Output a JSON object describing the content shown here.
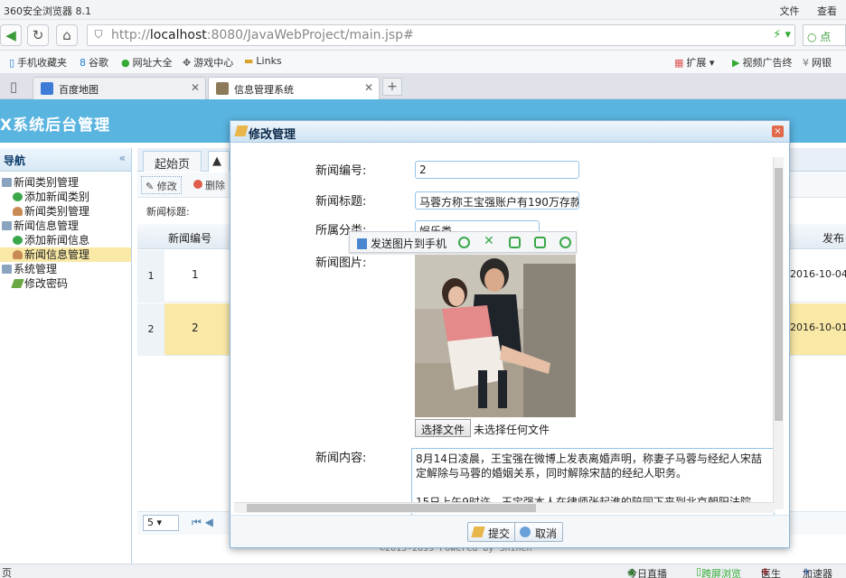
{
  "browser": {
    "title": "360安全浏览器 8.1",
    "menu": [
      "文件",
      "查看"
    ],
    "url_prefix": "http://",
    "url_host": "localhost",
    "url_rest": ":8080/JavaWebProject/main.jsp#",
    "search_text": "点",
    "bookmarks": [
      "手机收藏夹",
      "谷歌",
      "网址大全",
      "游戏中心",
      "Links",
      "扩展",
      "视频广告终",
      "网银"
    ],
    "tabs": [
      {
        "label": "百度地图"
      },
      {
        "label": "信息管理系统"
      }
    ],
    "new_tab": "+"
  },
  "app": {
    "title": "X系统后台管理",
    "sidebar_title": "导航",
    "collapse_glyph": "«",
    "tree": [
      {
        "label": "新闻类别管理",
        "level": 0,
        "icon": "folder"
      },
      {
        "label": "添加新闻类别",
        "level": 1,
        "icon": "add"
      },
      {
        "label": "新闻类别管理",
        "level": 1,
        "icon": "user"
      },
      {
        "label": "新闻信息管理",
        "level": 0,
        "icon": "folder"
      },
      {
        "label": "添加新闻信息",
        "level": 1,
        "icon": "add"
      },
      {
        "label": "新闻信息管理",
        "level": 1,
        "icon": "user",
        "selected": true
      },
      {
        "label": "系统管理",
        "level": 0,
        "icon": "folder"
      },
      {
        "label": "修改密码",
        "level": 1,
        "icon": "pen"
      }
    ],
    "main_tabs": [
      "起始页"
    ],
    "toolbar": {
      "edit": "修改",
      "delete": "删除"
    },
    "query_label": "新闻标题:",
    "grid": {
      "col_id": "新闻编号",
      "col_date": "发布",
      "rows": [
        {
          "rn": "1",
          "id": "1",
          "date": "2016-10-04"
        },
        {
          "rn": "2",
          "id": "2",
          "date": "2016-10-01"
        }
      ]
    },
    "pager_size": "5",
    "footer": "©2015-2099 Powered by Shihen"
  },
  "modal": {
    "title": "修改管理",
    "close": "×",
    "fields": {
      "id_label": "新闻编号:",
      "id_value": "2",
      "title_label": "新闻标题:",
      "title_value": "马蓉方称王宝强账户有190万存款",
      "category_label": "所属分类:",
      "category_value": "娱乐类",
      "image_label": "新闻图片:",
      "content_label": "新闻内容:"
    },
    "image_toolbar": {
      "send": "发送图片到手机"
    },
    "file_button": "选择文件",
    "file_status": "未选择任何文件",
    "content": [
      "8月14日凌晨，王宝强在微博上发表离婚声明，称妻子马蓉与经纪人宋喆",
      "定解除与马蓉的婚姻关系，同时解除宋喆的经纪人职务。",
      "15日上午9时许，王宝强本人在律师张起淮的陪同下来到北京朝阳法院，"
    ],
    "submit": "提交",
    "cancel": "取消"
  },
  "statusbar": [
    "页",
    "今日直播",
    "跨屏浏览",
    "医生",
    "加速器"
  ]
}
